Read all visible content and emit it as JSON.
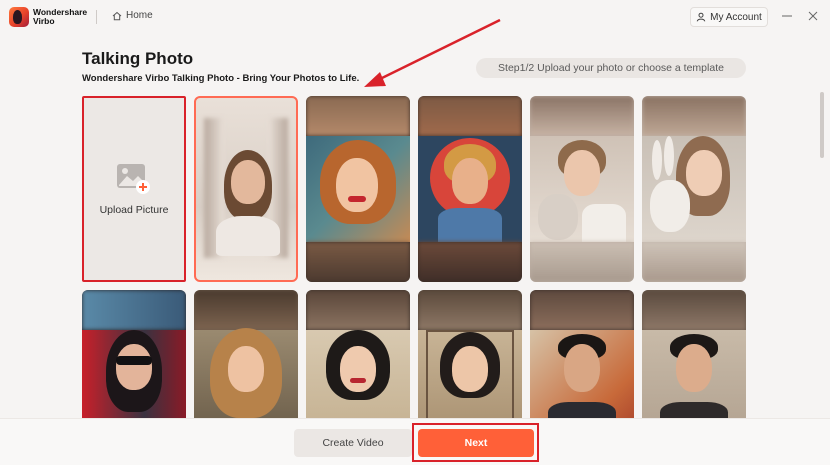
{
  "app": {
    "brand_line1": "Wondershare",
    "brand_line2": "Virbo",
    "home_label": "Home",
    "account_label": "My Account"
  },
  "header": {
    "title": "Talking Photo",
    "subtitle": "Wondershare Virbo Talking Photo - Bring Your Photos to Life.",
    "step": "Step1/2 Upload your photo or choose a template"
  },
  "upload": {
    "label": "Upload Picture"
  },
  "templates": [
    {
      "name": "template-woman-mirror",
      "selected": true
    },
    {
      "name": "template-vintage-pinup",
      "selected": false
    },
    {
      "name": "template-smiling-man-red",
      "selected": false
    },
    {
      "name": "template-boy-bunny",
      "selected": false
    },
    {
      "name": "template-girl-bunny",
      "selected": false
    },
    {
      "name": "template-woman-sunglasses",
      "selected": false
    },
    {
      "name": "template-woman-curls",
      "selected": false
    },
    {
      "name": "template-vintage-woman-1",
      "selected": false
    },
    {
      "name": "template-vintage-woman-2",
      "selected": false
    },
    {
      "name": "template-man-suit",
      "selected": false
    },
    {
      "name": "template-man-smile",
      "selected": false
    }
  ],
  "footer": {
    "create_label": "Create Video",
    "next_label": "Next"
  },
  "colors": {
    "accent": "#ff6038",
    "highlight": "#d9222a",
    "background": "#f6f4f3"
  }
}
